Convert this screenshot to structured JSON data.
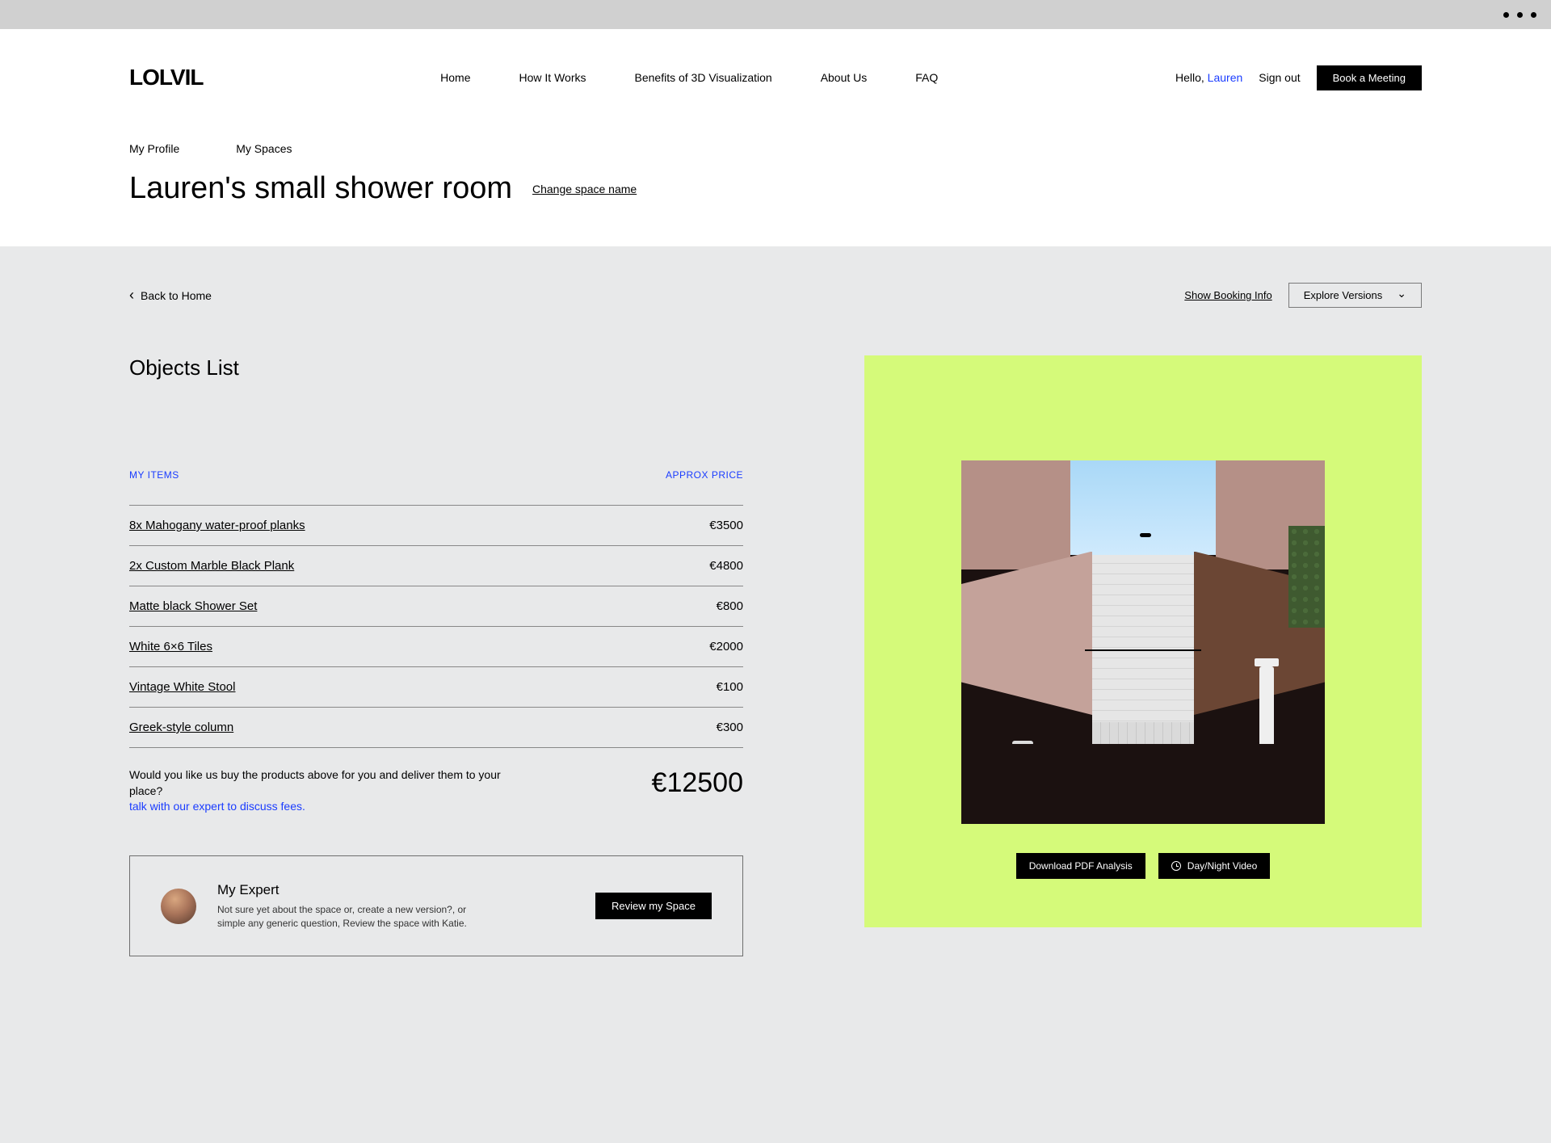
{
  "nav": {
    "home": "Home",
    "how": "How It Works",
    "benefits": "Benefits of 3D Visualization",
    "about": "About Us",
    "faq": "FAQ"
  },
  "account": {
    "hello": "Hello, ",
    "username": "Lauren",
    "signout": "Sign out",
    "book": "Book a Meeting"
  },
  "subnav": {
    "profile": "My Profile",
    "spaces": "My Spaces"
  },
  "title": "Lauren's small shower room",
  "change_name": "Change  space name",
  "back": "Back to Home",
  "show_booking": "Show Booking Info",
  "explore_versions": "Explore Versions",
  "objects_heading": "Objects List",
  "list_headers": {
    "items": "MY ITEMS",
    "price": "APPROX PRICE"
  },
  "items": [
    {
      "name": "8x Mahogany water-proof planks",
      "price": "€3500"
    },
    {
      "name": "2x Custom Marble Black Plank",
      "price": "€4800"
    },
    {
      "name": "Matte black Shower Set",
      "price": "€800"
    },
    {
      "name": "White 6×6 Tiles",
      "price": "€2000"
    },
    {
      "name": "Vintage White  Stool",
      "price": "€100"
    },
    {
      "name": "Greek-style column",
      "price": "€300"
    }
  ],
  "total_text": "Would you like us buy the products above for you and deliver them to your place?",
  "talk_link": "talk with our expert to discuss fees.",
  "total_amount": "€12500",
  "expert": {
    "title": "My Expert",
    "desc": "Not sure yet about the space or, create a new version?, or simple any generic question, Review the space with Katie.",
    "button": "Review my Space"
  },
  "render_actions": {
    "download": "Download PDF Analysis",
    "daynight": "Day/Night Video"
  },
  "logo": "LOLVIL"
}
